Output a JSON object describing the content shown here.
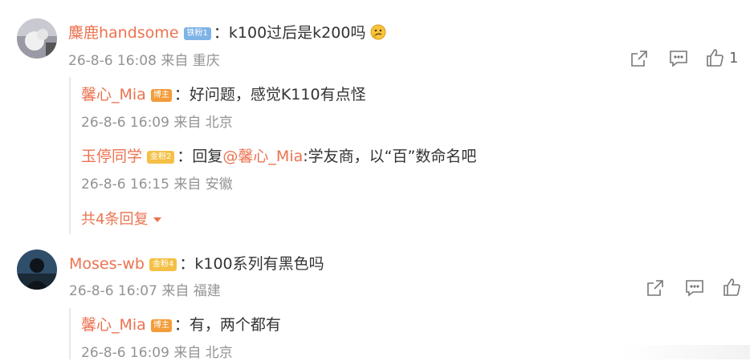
{
  "comments": [
    {
      "user": "麋鹿handsome",
      "badge": "铁粉1",
      "text": "k100过后是k200吗",
      "meta": "26-8-6 16:08 来自 重庆",
      "like_count": "1",
      "replies": [
        {
          "user": "馨心_Mia",
          "badge": "博主",
          "text": "好问题，感觉K110有点怪",
          "meta": "26-8-6 16:09 来自 北京"
        },
        {
          "user": "玉停同学",
          "badge": "金粉2",
          "text_prefix": "回复",
          "mention": "@馨心_Mia",
          "text": "学友商，以“百”数命名吧",
          "meta": "26-8-6 16:15 来自 安徽"
        }
      ],
      "more_replies": "共4条回复"
    },
    {
      "user": "Moses-wb",
      "badge": "金粉4",
      "text": "k100系列有黑色吗",
      "meta": "26-8-6 16:07 来自 福建",
      "replies": [
        {
          "user": "馨心_Mia",
          "badge": "博主",
          "text": "有，两个都有",
          "meta": "26-8-6 16:09 来自 北京"
        }
      ]
    }
  ],
  "colors": {
    "username": "#eb7350",
    "meta": "#939393",
    "text": "#333333"
  },
  "icons": [
    "share-icon",
    "comment-icon",
    "like-icon",
    "thinking-emoji-icon",
    "chevron-down-icon"
  ]
}
